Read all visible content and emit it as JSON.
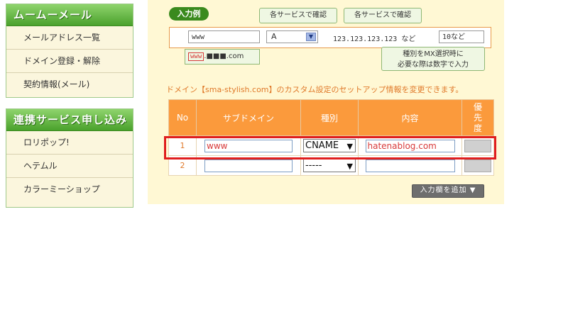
{
  "sidebar": {
    "muumuu": {
      "title": "ムームーメール",
      "items": [
        "メールアドレス一覧",
        "ドメイン登録・解除",
        "契約情報(メール)"
      ]
    },
    "linked": {
      "title": "連携サービス申し込み",
      "items": [
        "ロリポップ!",
        "ヘテムル",
        "カラーミーショップ"
      ]
    }
  },
  "example": {
    "badge": "入力例",
    "bubble_left": "各サービスで確認",
    "bubble_right": "各サービスで確認",
    "subdomain_value": "www",
    "type_value": "A",
    "content_value": "123.123.123.123 など",
    "priority_value": "10など",
    "sample_www": "www",
    "sample_suffix": ".■■■.com",
    "note_line1": "種別をMX選択時に",
    "note_line2": "必要な際は数字で入力"
  },
  "description": "ドメイン【sma-stylish.com】のカスタム設定のセットアップ情報を変更できます。",
  "table": {
    "headers": {
      "no": "No",
      "subdomain": "サブドメイン",
      "type": "種別",
      "content": "内容",
      "priority": "優\n先\n度"
    },
    "rows": [
      {
        "no": "1",
        "subdomain": "www",
        "type": "CNAME",
        "content": "hatenablog.com",
        "priority": ""
      },
      {
        "no": "2",
        "subdomain": "",
        "type": "-----",
        "content": "",
        "priority": ""
      }
    ]
  },
  "add_button": "入力欄を追加 ▼",
  "colors": {
    "accent_orange": "#fb9a3c",
    "highlight_red": "#e01e1e",
    "green_header": "#4aa12c"
  }
}
